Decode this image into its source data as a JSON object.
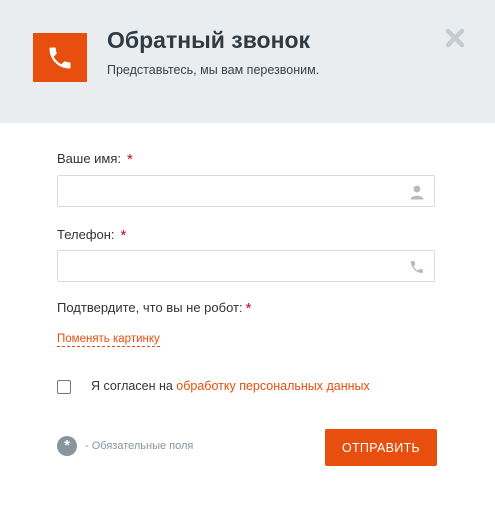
{
  "header": {
    "title": "Обратный звонок",
    "subtitle": "Представьтесь, мы вам перезвоним.",
    "phone_icon": "phone-icon",
    "close_icon": "close-icon"
  },
  "form": {
    "name_label": "Ваше имя:",
    "name_value": "",
    "name_icon": "user-icon",
    "phone_label": "Телефон:",
    "phone_value": "",
    "phone_icon": "phone-icon",
    "required_mark": "*",
    "captcha_label": "Подтвердите, что вы не робот:",
    "change_picture_link": "Поменять картинку",
    "consent_text": "Я согласен на",
    "consent_link": "обработку персональных данных",
    "consent_checked": false,
    "required_fields_note": "- Обязательные поля",
    "required_badge": "*",
    "submit_label": "Отправить"
  },
  "colors": {
    "accent": "#e84e0e",
    "header_bg": "#e9edf0",
    "required": "#d0021b",
    "muted": "#8a949b"
  }
}
